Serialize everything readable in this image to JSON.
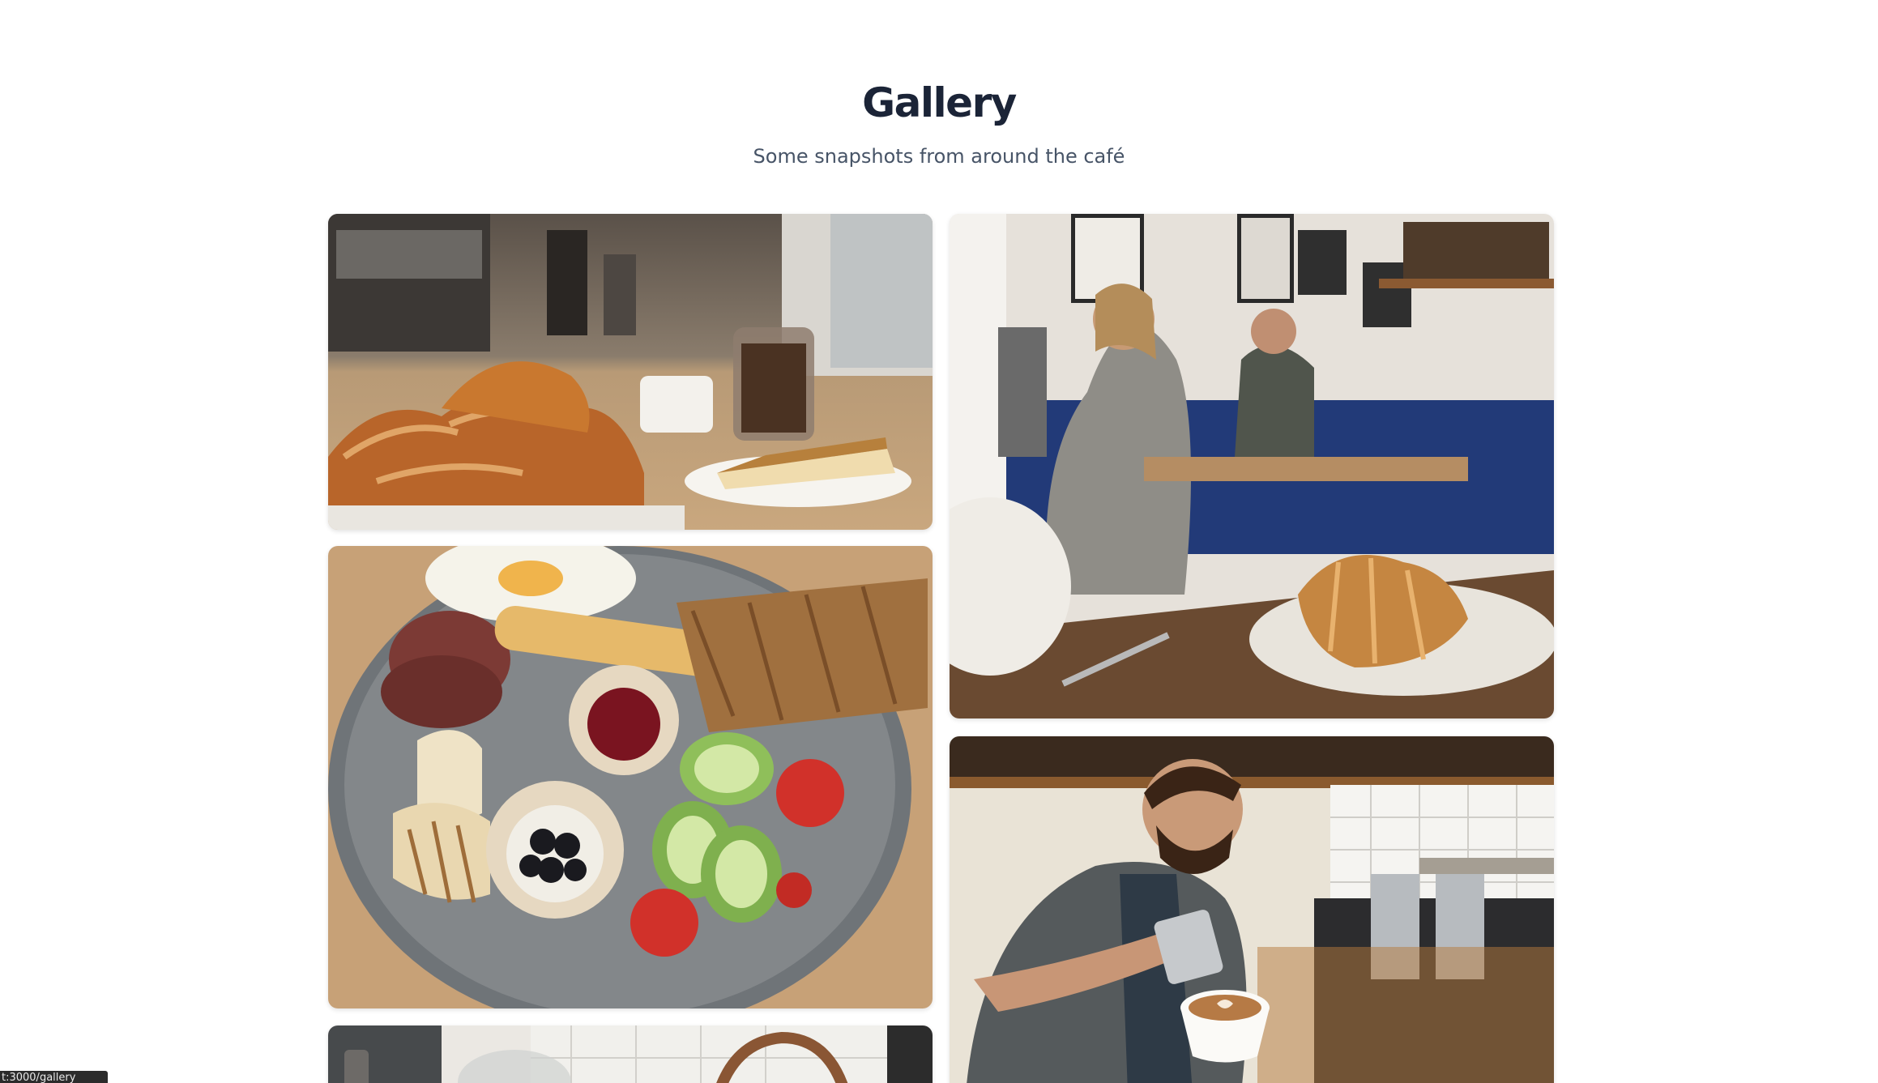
{
  "header": {
    "title": "Gallery",
    "subtitle": "Some snapshots from around the café"
  },
  "gallery": {
    "items": [
      {
        "subject": "croissants-coffee-pie-counter"
      },
      {
        "subject": "cafe-interior-customers-croissant"
      },
      {
        "subject": "breakfast-plate"
      },
      {
        "subject": "barista-latte-art"
      },
      {
        "subject": "coffee-equipment"
      }
    ]
  },
  "status_bar": {
    "url": "t:3000/gallery"
  },
  "colors": {
    "title": "#1b2437",
    "subtitle": "#475467",
    "background": "#ffffff"
  }
}
